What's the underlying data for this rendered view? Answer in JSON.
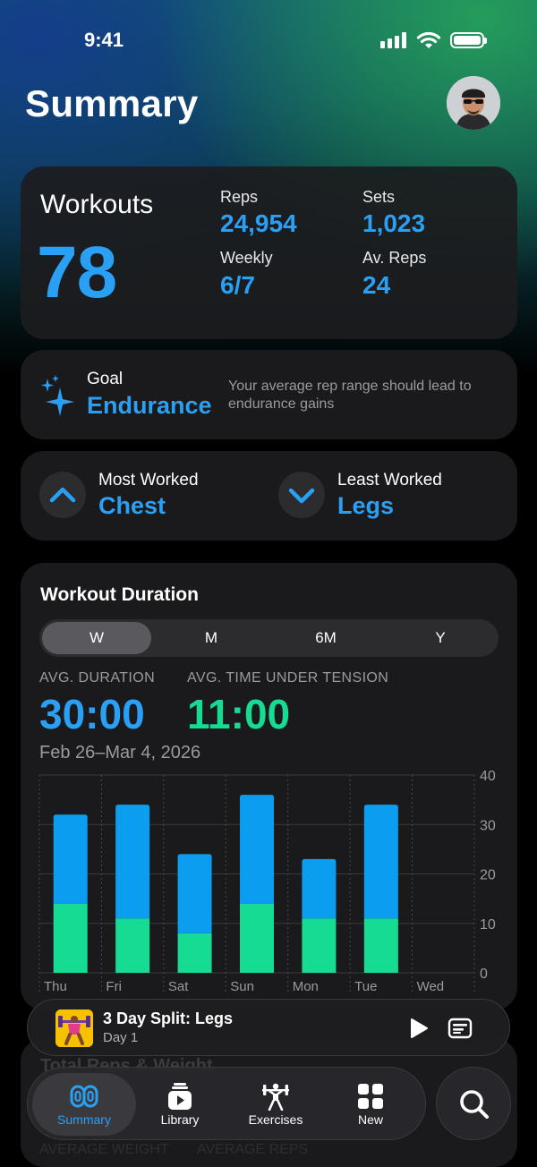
{
  "status_bar": {
    "time": "9:41"
  },
  "header": {
    "title": "Summary"
  },
  "workouts_card": {
    "label": "Workouts",
    "value": "78",
    "stats": [
      {
        "label": "Reps",
        "value": "24,954"
      },
      {
        "label": "Sets",
        "value": "1,023"
      },
      {
        "label": "Weekly",
        "value": "6/7"
      },
      {
        "label": "Av. Reps",
        "value": "24"
      }
    ]
  },
  "goal_card": {
    "label": "Goal",
    "value": "Endurance",
    "description": "Your average rep range should lead to endurance gains",
    "icon": "sparkles-icon"
  },
  "worked_card": {
    "most": {
      "label": "Most Worked",
      "value": "Chest",
      "icon": "chevron-up-icon"
    },
    "least": {
      "label": "Least Worked",
      "value": "Legs",
      "icon": "chevron-down-icon"
    }
  },
  "duration_card": {
    "title": "Workout Duration",
    "segments": [
      "W",
      "M",
      "6M",
      "Y"
    ],
    "selected_segment": "W",
    "avg_duration_label": "AVG. DURATION",
    "avg_duration_value": "30:00",
    "avg_tut_label": "AVG. TIME UNDER TENSION",
    "avg_tut_value": "11:00",
    "date_range": "Feb 26–Mar 4, 2026"
  },
  "chart_data": {
    "type": "bar",
    "stacked": true,
    "categories": [
      "Thu",
      "Fri",
      "Sat",
      "Sun",
      "Mon",
      "Tue",
      "Wed"
    ],
    "series": [
      {
        "values": [
          14,
          11,
          8,
          14,
          11,
          11,
          0
        ],
        "color": "#16db93"
      },
      {
        "values": [
          18,
          23,
          16,
          22,
          12,
          23,
          0
        ],
        "color": "#0b9df0"
      }
    ],
    "totals": [
      32,
      34,
      24,
      36,
      23,
      34,
      0
    ],
    "ylim": [
      0,
      40
    ],
    "yticks": [
      0,
      10,
      20,
      30,
      40
    ],
    "grid": true,
    "axis_position": "right"
  },
  "behind_content": {
    "title": "Total Reps & Weight",
    "left_label": "AVERAGE WEIGHT",
    "right_label": "AVERAGE REPS"
  },
  "now_playing": {
    "title": "3 Day Split: Legs",
    "subtitle": "Day 1",
    "play_icon": "play-icon",
    "card_icon": "workout-card-icon"
  },
  "tab_bar": {
    "tabs": [
      {
        "label": "Summary",
        "icon": "summary-rings-icon",
        "active": true
      },
      {
        "label": "Library",
        "icon": "library-icon",
        "active": false
      },
      {
        "label": "Exercises",
        "icon": "weightlifter-icon",
        "active": false
      },
      {
        "label": "New",
        "icon": "grid-icon",
        "active": false
      }
    ],
    "search_icon": "search-icon"
  },
  "colors": {
    "accent_blue": "#2aa0f5",
    "accent_green": "#16db93",
    "card_bg": "#1c1c1e"
  }
}
